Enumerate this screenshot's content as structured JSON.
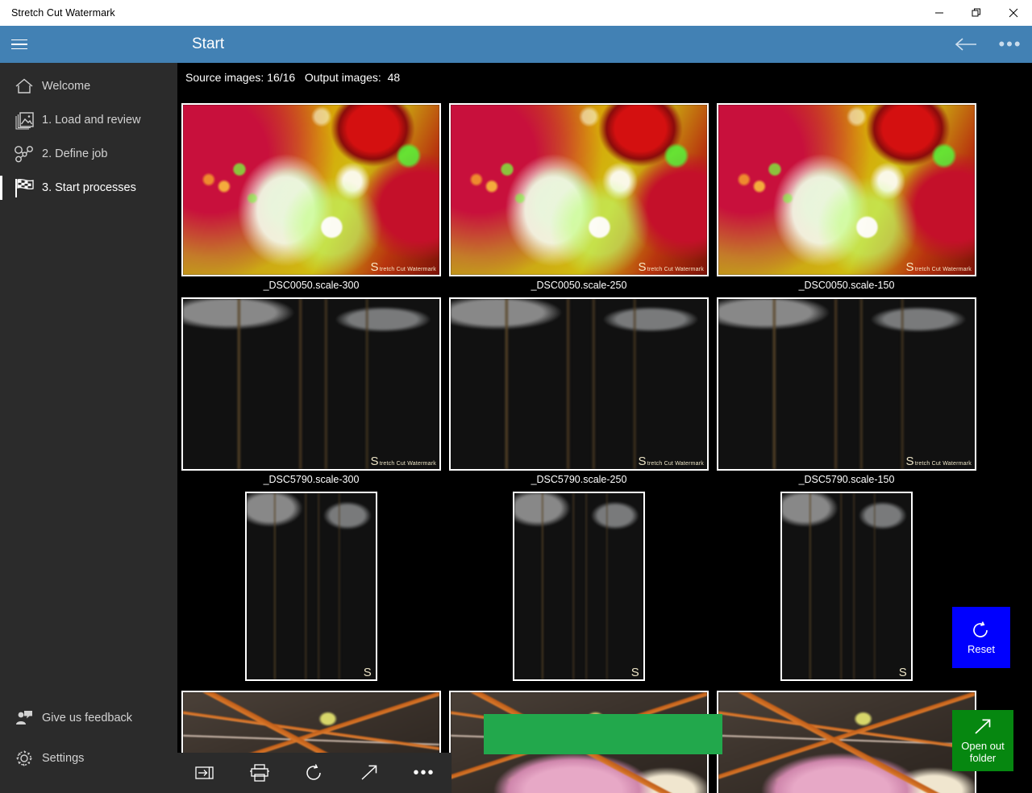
{
  "window": {
    "title": "Stretch Cut Watermark",
    "controls": [
      {
        "name": "minimize",
        "glyph": "minimize-icon"
      },
      {
        "name": "restore",
        "glyph": "restore-icon"
      },
      {
        "name": "close",
        "glyph": "close-icon"
      }
    ]
  },
  "header": {
    "title": "Start",
    "menu_icon": "hamburger-icon",
    "back_icon": "back-arrow-icon",
    "more_label": "•••",
    "accent_color": "#4281b4"
  },
  "sidebar": {
    "background": "#2b2b2b",
    "items": [
      {
        "label": "Welcome",
        "icon": "home-icon",
        "selected": false
      },
      {
        "label": "1. Load and review",
        "icon": "images-icon",
        "selected": false
      },
      {
        "label": "2. Define job",
        "icon": "job-nodes-icon",
        "selected": false
      },
      {
        "label": "3. Start processes",
        "icon": "checkered-flag-icon",
        "selected": true
      }
    ],
    "bottom_items": [
      {
        "label": "Give us feedback",
        "icon": "feedback-person-icon"
      },
      {
        "label": "Settings",
        "icon": "gear-icon"
      }
    ]
  },
  "status": {
    "text": "Source images: 16/16   Output images:  48",
    "source_label": "Source images:",
    "source_value": "16/16",
    "output_label": "Output images:",
    "output_value": "48"
  },
  "gallery": {
    "watermark_text": "tretch Cut Watermark",
    "watermark_initial": "S",
    "rows": [
      {
        "kind": "landscape",
        "cells": [
          {
            "caption": "_DSC0050.scale-300",
            "photo": "xmas"
          },
          {
            "caption": "_DSC0050.scale-250",
            "photo": "xmas"
          },
          {
            "caption": "_DSC0050.scale-150",
            "photo": "xmas"
          }
        ]
      },
      {
        "kind": "landscape",
        "cells": [
          {
            "caption": "_DSC5790.scale-300",
            "photo": "tulip"
          },
          {
            "caption": "_DSC5790.scale-250",
            "photo": "tulip"
          },
          {
            "caption": "_DSC5790.scale-150",
            "photo": "tulip"
          }
        ]
      },
      {
        "kind": "portrait",
        "cells": [
          {
            "caption": "",
            "photo": "tulip"
          },
          {
            "caption": "",
            "photo": "tulip"
          },
          {
            "caption": "",
            "photo": "tulip"
          }
        ]
      },
      {
        "kind": "crop",
        "cells": [
          {
            "caption": "",
            "photo": "lily"
          },
          {
            "caption": "",
            "photo": "lily"
          },
          {
            "caption": "",
            "photo": "lily"
          }
        ]
      }
    ]
  },
  "overlay": {
    "green_rect_color": "#22a84c"
  },
  "actions": {
    "reset_label": "Reset",
    "reset_icon": "refresh-icon",
    "reset_color": "#0000fe",
    "open_label": "Open out\nfolder",
    "open_label_line1": "Open out",
    "open_label_line2": "folder",
    "open_icon": "open-external-icon",
    "open_color": "#068710"
  },
  "commandbar": {
    "buttons": [
      {
        "name": "import-icon",
        "label": ""
      },
      {
        "name": "print-icon",
        "label": ""
      },
      {
        "name": "refresh-icon",
        "label": ""
      },
      {
        "name": "open-external-icon",
        "label": ""
      },
      {
        "name": "more-icon",
        "label": "•••"
      }
    ]
  }
}
